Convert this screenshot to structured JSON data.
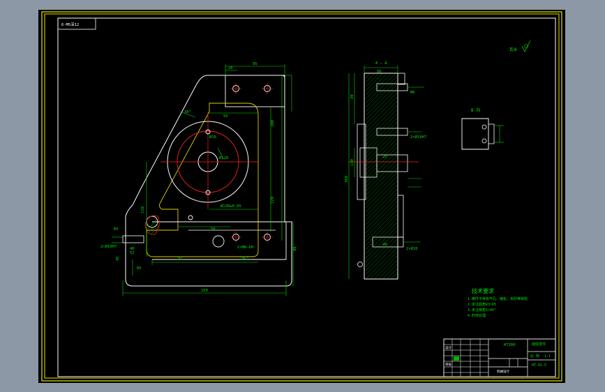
{
  "colors": {
    "background_outer": "#8c98a6",
    "canvas": "#000000",
    "border_yellow": "#e8e800",
    "frame_white": "#ffffff",
    "dimension_green": "#00e000",
    "geometry_white": "#ffffff",
    "center_red": "#ff2020",
    "hatch_green": "#00c000",
    "hidden_yellow": "#e0d000",
    "accent_cyan": "#00c8ff"
  },
  "corner_note": "6-M5深12",
  "section_label": "A — A",
  "detail_label": "B 向",
  "roughness_note": "其余",
  "dims": {
    "top_width": "95",
    "left_ext": "20",
    "right_ext": "55",
    "angle": "30°",
    "small_bore": "Ø10",
    "big_bore": "Ø120",
    "bore_height": "180",
    "side_height": "120",
    "hole_spacing": "110",
    "bottom_ext": "92",
    "right_lower": "162",
    "overall_width": "250",
    "height_total": "360",
    "base_height": "45",
    "pitch": "52",
    "left_small": "40",
    "base_width": "50",
    "view_top": "56",
    "view_depth": "20",
    "pos_a": "130",
    "right_h": "80"
  },
  "callouts": {
    "left_hole": "2×Ø10H7",
    "bore_tol": "Ø130±0.05",
    "thread": "2×M8-6H",
    "fillet": "R5",
    "section_thread": "M6",
    "section_note": "2×Ø10H7",
    "section_bottom": "2×Ø20",
    "roughness_val": "Ra3.2",
    "section_r": "R5"
  },
  "tech_requirements": {
    "title": "技术要求",
    "items": [
      "1.铸件不得有气孔、缩松、夹砂等缺陷",
      "2.未注圆角R3~R5",
      "3.未注倒角1×45°",
      "4.时效处理"
    ]
  },
  "title_block": {
    "material": "HT200",
    "part_name": "阀体零件",
    "scale_label": "比 例",
    "scale_val": "1:1",
    "drawing_no": "HT-01-5",
    "designer": "设计",
    "checker": "审核",
    "company": "机械设计"
  }
}
